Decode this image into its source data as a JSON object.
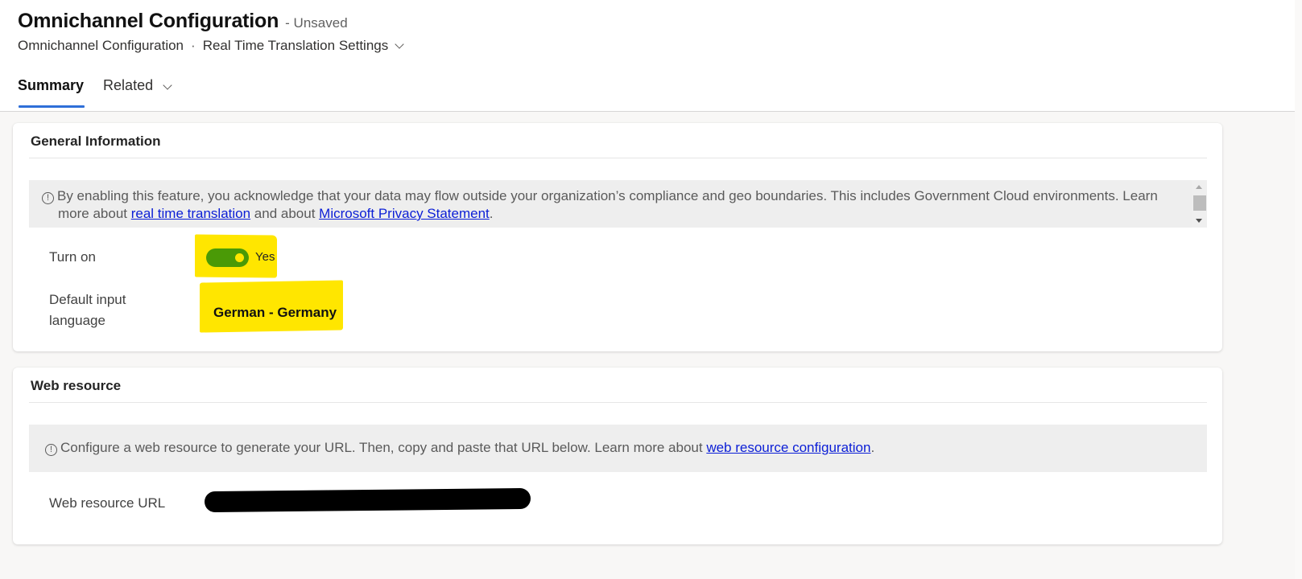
{
  "header": {
    "title": "Omnichannel Configuration",
    "save_state": "- Unsaved",
    "entity_name": "Omnichannel Configuration",
    "separator": "·",
    "form_name": "Real Time Translation Settings"
  },
  "tabs": [
    {
      "label": "Summary",
      "active": true
    },
    {
      "label": "Related",
      "active": false,
      "has_dropdown": true
    }
  ],
  "sections": {
    "general": {
      "title": "General Information",
      "notice": {
        "icon": "info-circle-icon",
        "text_1": "By enabling this feature, you acknowledge that your data may flow outside your organization’s compliance and geo boundaries. This includes Government Cloud environments. Learn",
        "text_2": "more about ",
        "link_1": "real time translation",
        "text_3": " and about ",
        "link_2": "Microsoft Privacy Statement",
        "text_4": "."
      },
      "fields": {
        "turn_on": {
          "label": "Turn on",
          "value": true,
          "value_text": "Yes"
        },
        "default_language": {
          "label": "Default input language",
          "value": "German - Germany"
        }
      }
    },
    "web_resource": {
      "title": "Web resource",
      "notice": {
        "icon": "info-circle-icon",
        "text_1": "Configure a web resource to generate your URL. Then, copy and paste that URL below. Learn more about ",
        "link": "web resource configuration",
        "text_2": "."
      },
      "fields": {
        "url": {
          "label": "Web resource URL",
          "value": "[redacted]"
        }
      }
    }
  },
  "colors": {
    "toggle_on": "#4a9a06",
    "highlight": "#ffe600",
    "tab_underline": "#2f6fd8",
    "link": "#0b1ed6"
  }
}
